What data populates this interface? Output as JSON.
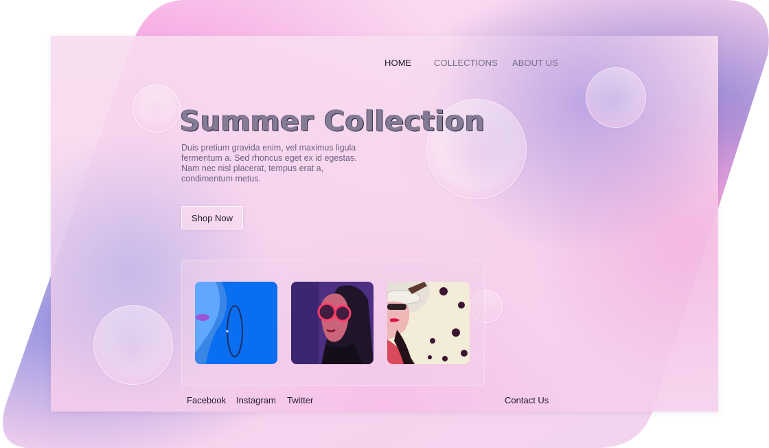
{
  "nav": {
    "items": [
      {
        "label": "HOME",
        "active": true
      },
      {
        "label": "COLLECTIONS",
        "active": false
      },
      {
        "label": "ABOUT US",
        "active": false
      }
    ]
  },
  "hero": {
    "title": "Summer Collection",
    "description": "Duis pretium gravida enim, vel maximus ligula fermentum a. Sed rhoncus eget ex id egestas. Nam nec nisl placerat, tempus erat a, condimentum metus.",
    "cta_label": "Shop Now"
  },
  "gallery": {
    "images": [
      {
        "subject": "woman-blue-neon-hoop-earring"
      },
      {
        "subject": "woman-red-round-glasses-purple-light"
      },
      {
        "subject": "woman-hat-polka-dots"
      }
    ]
  },
  "footer": {
    "links": [
      "Facebook",
      "Instagram",
      "Twitter"
    ],
    "contact_label": "Contact Us"
  },
  "colors": {
    "accent_pink": "#f7b2e4",
    "accent_lavender": "#8c7fd0",
    "text_dark": "#1f1a2b",
    "text_muted": "#777088"
  }
}
